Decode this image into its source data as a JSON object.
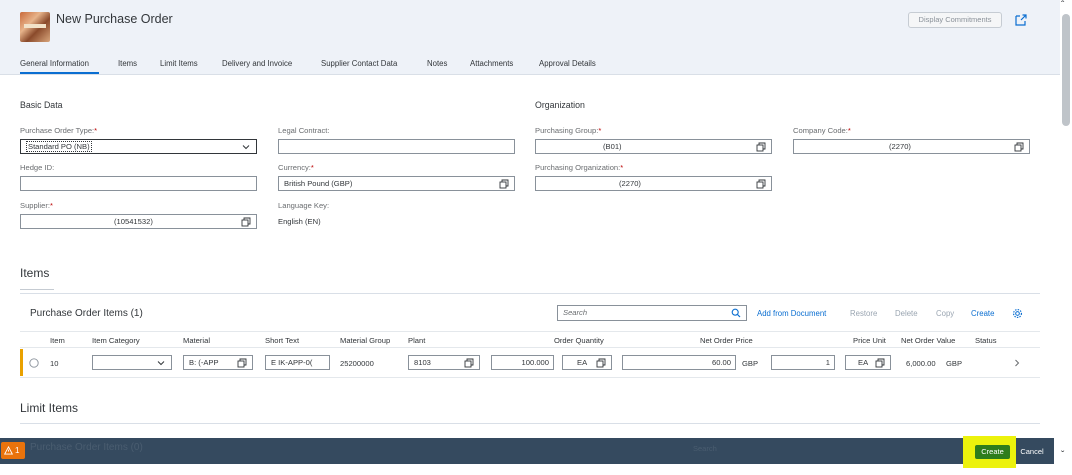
{
  "header": {
    "title": "New Purchase Order",
    "display_commitments": "Display Commitments"
  },
  "tabs": [
    {
      "label": "General Information"
    },
    {
      "label": "Items"
    },
    {
      "label": "Limit Items"
    },
    {
      "label": "Delivery and Invoice"
    },
    {
      "label": "Supplier Contact Data"
    },
    {
      "label": "Notes"
    },
    {
      "label": "Attachments"
    },
    {
      "label": "Approval Details"
    }
  ],
  "basic_data": {
    "title": "Basic Data",
    "po_type_label": "Purchase Order Type:",
    "po_type_value": "Standard PO (NB)",
    "legal_contract_label": "Legal Contract:",
    "legal_contract_value": "",
    "hedge_label": "Hedge ID:",
    "hedge_value": "",
    "currency_label": "Currency:",
    "currency_value": "British Pound (GBP)",
    "supplier_label": "Supplier:",
    "supplier_value": "(10541532)",
    "language_label": "Language Key:",
    "language_value": "English (EN)"
  },
  "organization": {
    "title": "Organization",
    "purch_group_label": "Purchasing Group:",
    "purch_group_value": "(B01)",
    "company_code_label": "Company Code:",
    "company_code_value": "(2270)",
    "purch_org_label": "Purchasing Organization:",
    "purch_org_value": "(2270)"
  },
  "required_mark": "*",
  "items_section": {
    "title": "Items",
    "table_title": "Purchase Order Items (1)",
    "search_placeholder": "Search",
    "actions": {
      "add_from_document": "Add from Document",
      "restore": "Restore",
      "delete": "Delete",
      "copy": "Copy",
      "create": "Create"
    },
    "columns": {
      "item": "Item",
      "item_category": "Item Category",
      "material": "Material",
      "short_text": "Short Text",
      "material_group": "Material Group",
      "plant": "Plant",
      "order_quantity": "Order Quantity",
      "net_order_price": "Net Order Price",
      "price_unit": "Price Unit",
      "net_order_value": "Net Order Value",
      "status": "Status"
    },
    "row": {
      "item": "10",
      "item_category": "",
      "material": "B: (-APP",
      "short_text": "E  IK-APP-0(",
      "material_group": "25200000",
      "plant": "8103",
      "quantity": "100.000",
      "uom": "EA",
      "price": "60.00",
      "currency": "GBP",
      "price_unit": "1",
      "price_uom": "EA",
      "net_value": "6,000.00",
      "net_currency": "GBP"
    }
  },
  "limit_items": {
    "title": "Limit Items",
    "ghost_title": "Purchase Order Items (0)",
    "ghost_search": "Search"
  },
  "footer": {
    "warning_count": "1",
    "create": "Create",
    "cancel": "Cancel"
  }
}
